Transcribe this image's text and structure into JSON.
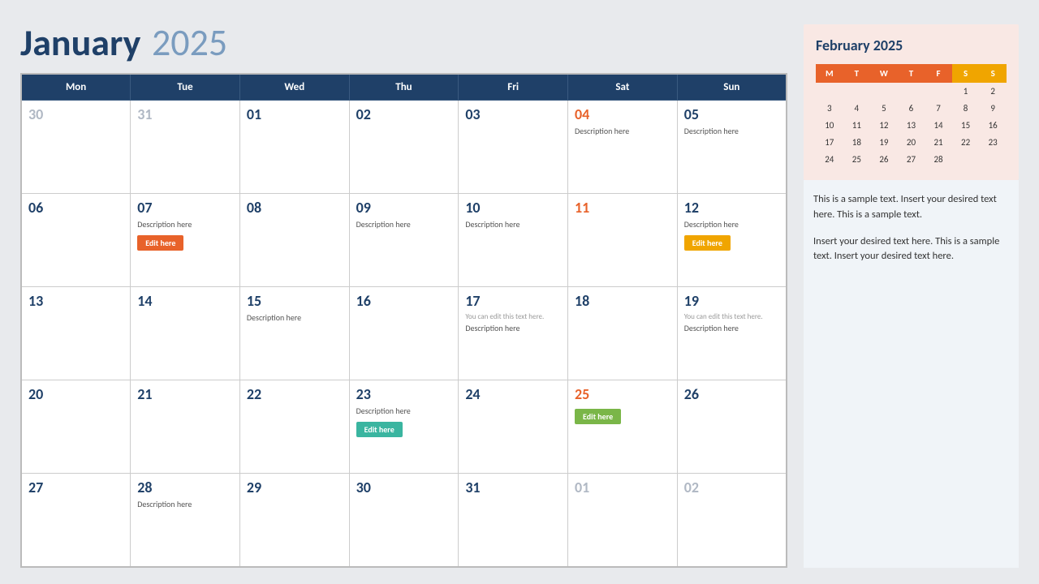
{
  "header": {
    "month": "January",
    "year": "2025"
  },
  "weekdays": [
    "Mon",
    "Tue",
    "Wed",
    "Thu",
    "Fri",
    "Sat",
    "Sun"
  ],
  "weeks": [
    [
      {
        "num": "30",
        "muted": true
      },
      {
        "num": "31",
        "muted": true
      },
      {
        "num": "01"
      },
      {
        "num": "02"
      },
      {
        "num": "03"
      },
      {
        "num": "04",
        "orange": true,
        "desc": "Description here"
      },
      {
        "num": "05",
        "desc": "Description here"
      }
    ],
    [
      {
        "num": "06"
      },
      {
        "num": "07",
        "desc": "Description here",
        "btn": "Edit here",
        "btnColor": "red"
      },
      {
        "num": "08"
      },
      {
        "num": "09",
        "desc": "Description here"
      },
      {
        "num": "10",
        "desc": "Description here"
      },
      {
        "num": "11",
        "orange": true
      },
      {
        "num": "12",
        "desc": "Description here",
        "btn": "Edit here",
        "btnColor": "orange"
      }
    ],
    [
      {
        "num": "13"
      },
      {
        "num": "14"
      },
      {
        "num": "15",
        "desc": "Description here"
      },
      {
        "num": "16"
      },
      {
        "num": "17",
        "hint": "You can edit this text here.",
        "desc": "Description here"
      },
      {
        "num": "18"
      },
      {
        "num": "19",
        "hint": "You can edit this text here.",
        "desc": "Description here"
      }
    ],
    [
      {
        "num": "20"
      },
      {
        "num": "21"
      },
      {
        "num": "22"
      },
      {
        "num": "23",
        "desc": "Description here",
        "btn": "Edit here",
        "btnColor": "teal"
      },
      {
        "num": "24"
      },
      {
        "num": "25",
        "orange": true,
        "btn": "Edit here",
        "btnColor": "green"
      },
      {
        "num": "26"
      }
    ],
    [
      {
        "num": "27"
      },
      {
        "num": "28",
        "desc": "Description here"
      },
      {
        "num": "29"
      },
      {
        "num": "30"
      },
      {
        "num": "31"
      },
      {
        "num": "01",
        "muted": true
      },
      {
        "num": "02",
        "muted": true
      }
    ]
  ],
  "miniCal": {
    "title": "February 2025",
    "headers": [
      "M",
      "T",
      "W",
      "T",
      "F",
      "S",
      "S"
    ],
    "rows": [
      [
        null,
        null,
        null,
        null,
        null,
        "1",
        "2"
      ],
      [
        "3",
        "4",
        "5",
        "6",
        "7",
        "8",
        "9"
      ],
      [
        "10",
        "11",
        "12",
        "13",
        "14",
        "15",
        "16"
      ],
      [
        "17",
        "18",
        "19",
        "20",
        "21",
        "22",
        "23"
      ],
      [
        "24",
        "25",
        "26",
        "27",
        "28",
        null,
        null
      ]
    ]
  },
  "notes": {
    "para1": "This is a sample text. Insert your desired text here. This is a sample text.",
    "para2": "Insert your desired text here. This is a sample text. Insert your desired text here."
  }
}
